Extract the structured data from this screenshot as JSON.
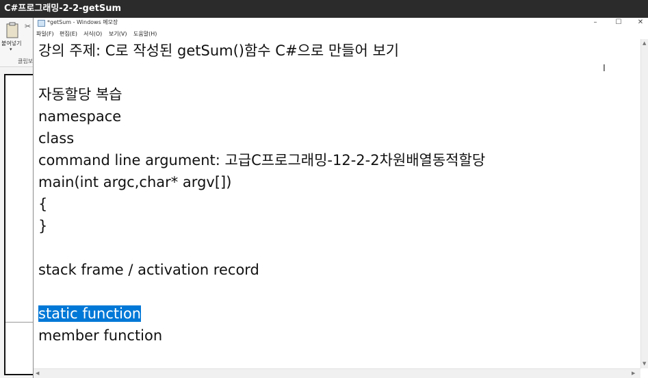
{
  "video_title": "C#프로그래밍-2-2-getSum",
  "background_app": {
    "paste_label": "붙여넣기",
    "clipboard_label": "클립보",
    "cut_icon_name": "scissors-icon",
    "paste_icon_name": "clipboard-paste-icon"
  },
  "notepad": {
    "title": "*getSum - Windows 메모장",
    "menu": [
      "파일(F)",
      "편집(E)",
      "서식(O)",
      "보기(V)",
      "도움말(H)"
    ],
    "window_buttons": {
      "minimize": "–",
      "maximize": "☐",
      "close": "✕"
    },
    "lines": [
      "강의 주제: C로 작성된 getSum()함수 C#으로 만들어 보기",
      "",
      "자동할당 복습",
      "namespace",
      "class",
      "command line argument: 고급C프로그래밍-12-2-2차원배열동적할당",
      "main(int argc,char* argv[])",
      "{",
      "}",
      "",
      "stack frame / activation record",
      "",
      "static function",
      "member function"
    ],
    "selected_line_index": 12,
    "colors": {
      "selection": "#0078d7",
      "text": "#111111"
    }
  }
}
